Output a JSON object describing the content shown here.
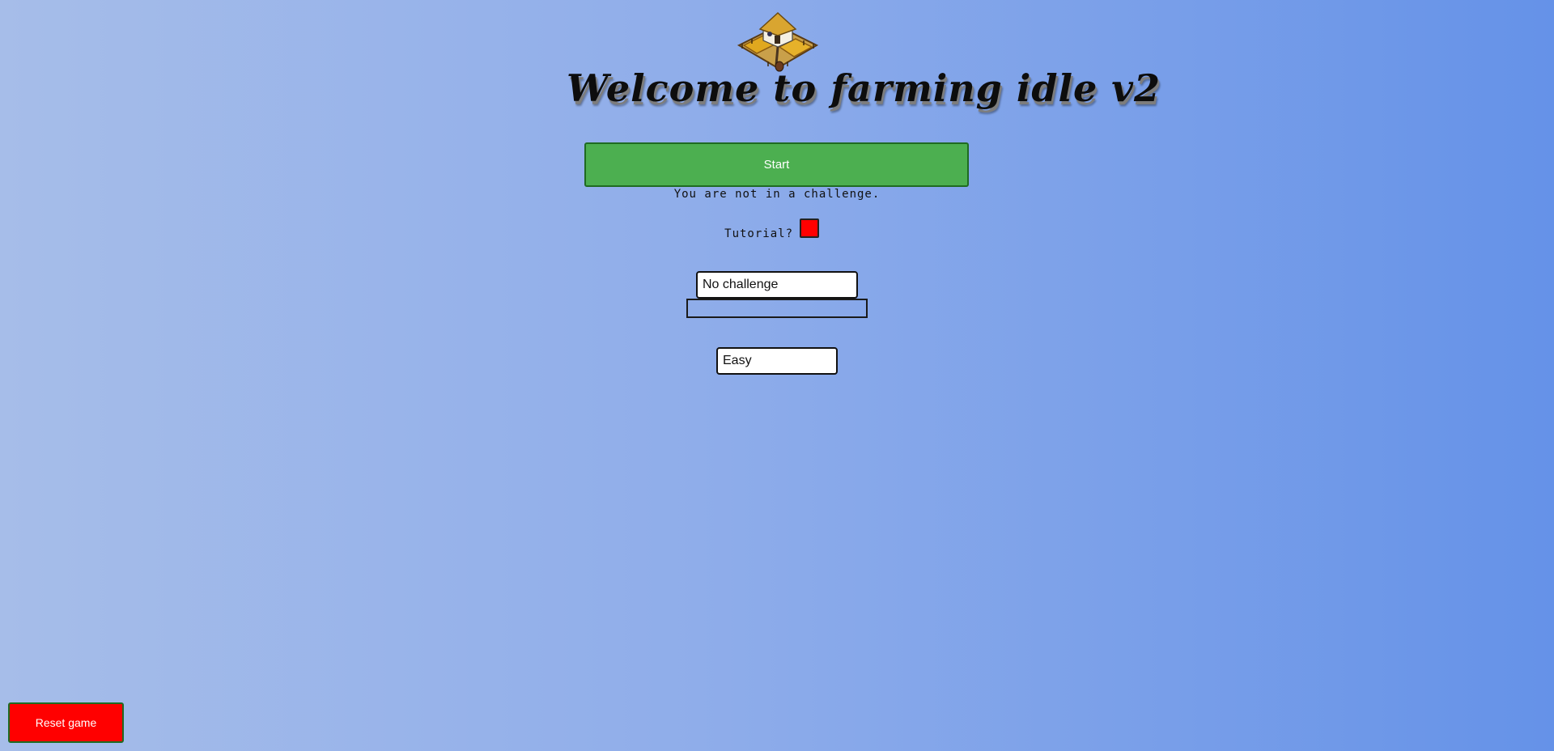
{
  "title": "Welcome to farming idle v2",
  "logo_icon": "farmhouse-icon",
  "start_button": {
    "label": "Start",
    "color": "#4caf50"
  },
  "challenge_status": "You are not in a challenge.",
  "tutorial": {
    "label": "Tutorial?",
    "checked_color": "#ff0000"
  },
  "challenge_select": {
    "value": "No challenge"
  },
  "challenge_description": "",
  "difficulty_select": {
    "value": "Easy"
  },
  "reset_button": {
    "label": "Reset game",
    "color": "#ff0000"
  },
  "background": {
    "from": "#a6bde9",
    "to": "#6592e8"
  }
}
